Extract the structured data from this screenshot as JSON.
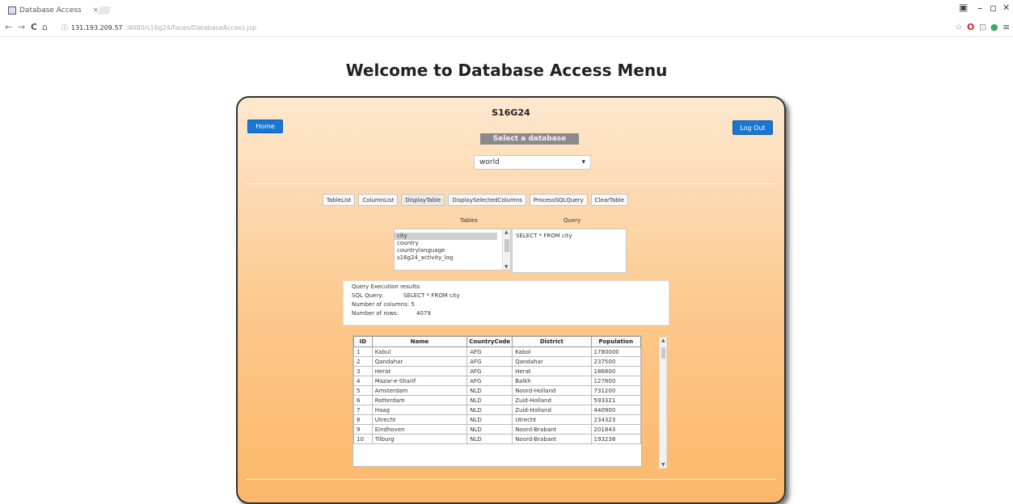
{
  "browser": {
    "tab_title": "Database Access",
    "tab_close": "×",
    "url_host": "131.193.209.57",
    "url_path": ":8080/s16g24/faces/DatabaseAccess.jsp",
    "win_min": "–",
    "win_max": "▫",
    "win_close": "✕",
    "back": "←",
    "forward": "→",
    "reload": "C",
    "home": "⌂",
    "star": "☆",
    "menu": "≡"
  },
  "page": {
    "title": "Welcome to Database Access Menu",
    "user": "S16G24",
    "home_button": "Home",
    "logout_button": "Log Out",
    "select_db_label": "Select a database",
    "db_selected": "world",
    "db_caret": "▾"
  },
  "tabs": [
    "TableList",
    "ColumnList",
    "DisplayTable",
    "DisplaySelectedColumns",
    "ProcessSQLQuery",
    "ClearTable"
  ],
  "labels": {
    "tables": "Tables",
    "query": "Query"
  },
  "tables_list": [
    "city",
    "country",
    "countrylanguage",
    "s16g24_activity_log"
  ],
  "query_text": "SELECT * FROM city",
  "results": {
    "heading": "Query Execution results:",
    "sql_label": "SQL Query:",
    "sql_value": "SELECT * FROM city",
    "columns_label": "Number of columns:",
    "columns_value": "5",
    "rows_label": "Number of rows:",
    "rows_value": "4079"
  },
  "table": {
    "headers": [
      "ID",
      "Name",
      "CountryCode",
      "District",
      "Population"
    ],
    "rows": [
      [
        "1",
        "Kabul",
        "AFG",
        "Kabol",
        "1780000"
      ],
      [
        "2",
        "Qandahar",
        "AFG",
        "Qandahar",
        "237500"
      ],
      [
        "3",
        "Herat",
        "AFG",
        "Herat",
        "186800"
      ],
      [
        "4",
        "Mazar-e-Sharif",
        "AFG",
        "Balkh",
        "127800"
      ],
      [
        "5",
        "Amsterdam",
        "NLD",
        "Noord-Holland",
        "731200"
      ],
      [
        "6",
        "Rotterdam",
        "NLD",
        "Zuid-Holland",
        "593321"
      ],
      [
        "7",
        "Haag",
        "NLD",
        "Zuid-Holland",
        "440900"
      ],
      [
        "8",
        "Utrecht",
        "NLD",
        "Utrecht",
        "234323"
      ],
      [
        "9",
        "Eindhoven",
        "NLD",
        "Noord-Brabant",
        "201843"
      ],
      [
        "10",
        "Tilburg",
        "NLD",
        "Noord-Brabant",
        "193238"
      ]
    ]
  }
}
